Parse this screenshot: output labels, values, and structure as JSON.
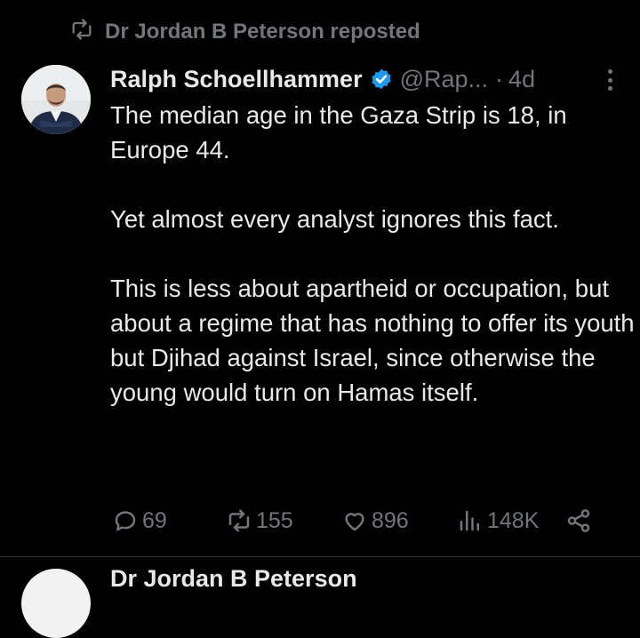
{
  "repost": {
    "label": "Dr Jordan B Peterson reposted",
    "icon": "repost-icon"
  },
  "tweet": {
    "author_name": "Ralph Schoellhammer",
    "handle": "@Rap...",
    "separator": "·",
    "time": "4d",
    "verified_icon": "verified-badge-icon",
    "paragraphs": [
      "The median age in the Gaza Strip is 18, in Europe 44.",
      "Yet almost every analyst ignores this fact.",
      "This is less about apartheid or occupation, but about a regime that has nothing to offer its youth but Djihad against Israel, since otherwise the young would turn on Hamas itself."
    ],
    "actions": {
      "replies": "69",
      "reposts": "155",
      "likes": "896",
      "views": "148K"
    }
  },
  "next_tweet": {
    "author_name_partial": "Dr Jordan B Peterson"
  },
  "colors": {
    "background": "#000000",
    "text": "#e7e9ea",
    "muted": "#71767b",
    "verified": "#1d9bf0",
    "divider": "#2f3336"
  }
}
